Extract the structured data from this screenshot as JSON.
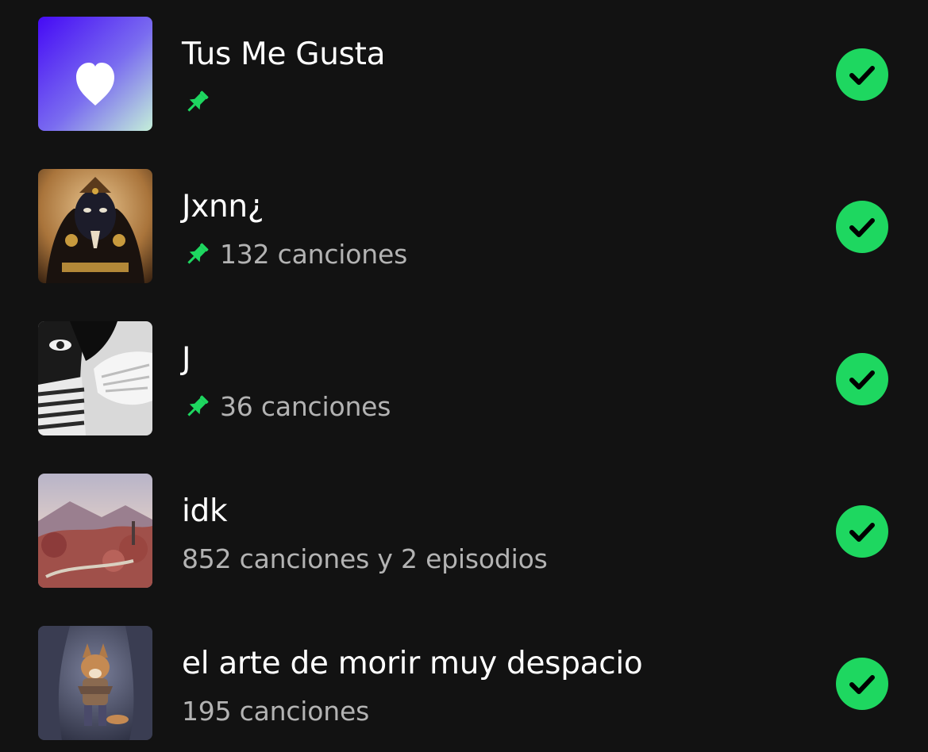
{
  "colors": {
    "background": "#121212",
    "accent": "#1ed760",
    "title": "#ffffff",
    "subtitle": "#b3b3b3"
  },
  "library": {
    "items": [
      {
        "title": "Tus Me Gusta",
        "subtitle": "",
        "pinned": true,
        "downloaded": true,
        "cover": "liked-songs-heart-gradient"
      },
      {
        "title": "Jxnn¿",
        "subtitle": "132 canciones",
        "pinned": true,
        "downloaded": true,
        "cover": "goddess-portrait-artwork"
      },
      {
        "title": "J",
        "subtitle": "36 canciones",
        "pinned": true,
        "downloaded": true,
        "cover": "black-and-white-photo"
      },
      {
        "title": "idk",
        "subtitle": "852 canciones y 2 episodios",
        "pinned": false,
        "downloaded": true,
        "cover": "autumn-landscape-painting"
      },
      {
        "title": "el arte de morir muy despacio",
        "subtitle": "195 canciones",
        "pinned": false,
        "downloaded": true,
        "cover": "fox-character-artwork"
      }
    ]
  }
}
